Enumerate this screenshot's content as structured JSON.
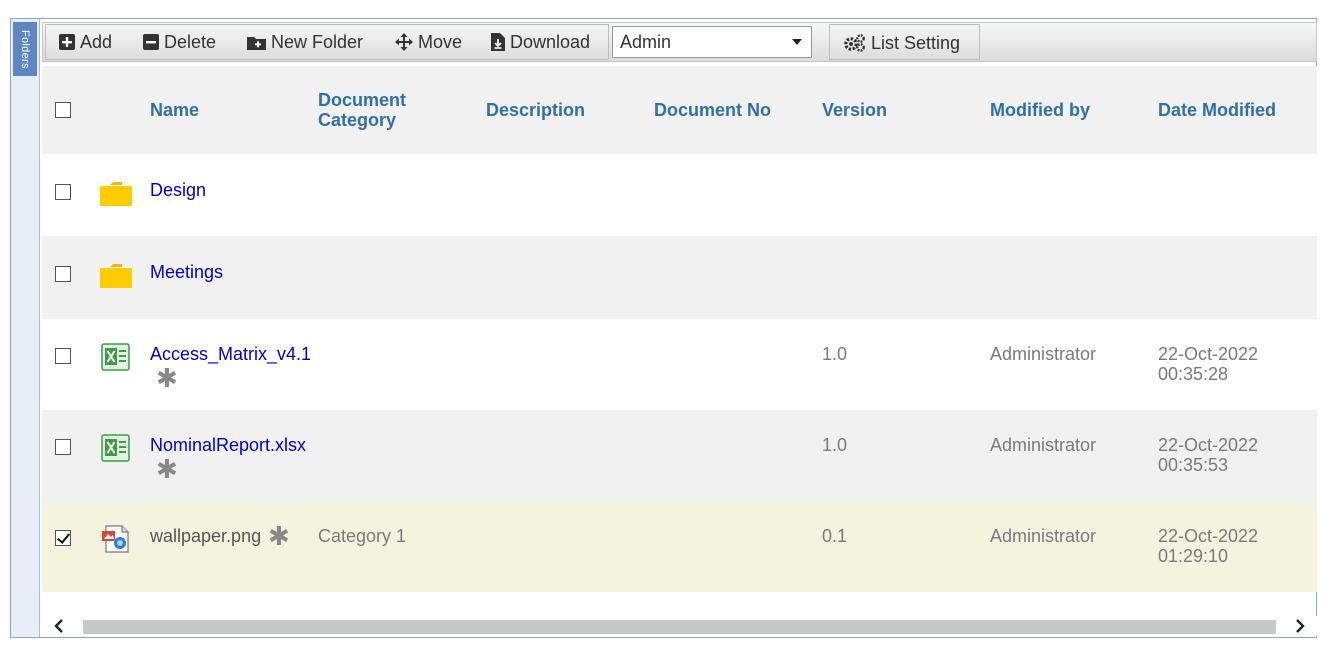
{
  "sidebar": {
    "folders_label": "Folders"
  },
  "toolbar": {
    "add_label": "Add",
    "delete_label": "Delete",
    "new_folder_label": "New Folder",
    "move_label": "Move",
    "download_label": "Download",
    "folder_select_value": "Admin",
    "list_setting_label": "List Setting"
  },
  "table": {
    "columns": [
      "Name",
      "Document Category",
      "Description",
      "Document No",
      "Version",
      "Modified by",
      "Date Modified"
    ],
    "rows": [
      {
        "type": "folder",
        "name": "Design",
        "checked": false
      },
      {
        "type": "folder",
        "name": "Meetings",
        "checked": false
      },
      {
        "type": "excel",
        "name": "Access_Matrix_v4.1",
        "category": "",
        "version": "1.0",
        "modified_by": "Administrator",
        "date": "22-Oct-2022",
        "time": "00:35:28",
        "checked": false
      },
      {
        "type": "excel",
        "name": "NominalReport.xlsx",
        "category": "",
        "version": "1.0",
        "modified_by": "Administrator",
        "date": "22-Oct-2022",
        "time": "00:35:53",
        "checked": false
      },
      {
        "type": "image",
        "name": "wallpaper.png",
        "category": "Category 1",
        "version": "0.1",
        "modified_by": "Administrator",
        "date": "22-Oct-2022",
        "time": "01:29:10",
        "checked": true
      }
    ]
  },
  "icons": {
    "add": "plus-square-icon",
    "delete": "minus-square-icon",
    "new_folder": "folder-plus-icon",
    "move": "move-arrows-icon",
    "download": "download-file-icon",
    "list_setting": "gears-icon",
    "folder": "folder-icon",
    "excel": "excel-file-icon",
    "image": "image-file-icon",
    "asterisk": "asterisk-icon",
    "scroll_left": "chevron-left-icon",
    "scroll_right": "chevron-right-icon"
  },
  "colors": {
    "header_text": "#2f6faa",
    "link": "#0000cc",
    "selected_row": "#f4f4de",
    "folder": "#ffcc00",
    "excel": "#3f9a4a"
  }
}
